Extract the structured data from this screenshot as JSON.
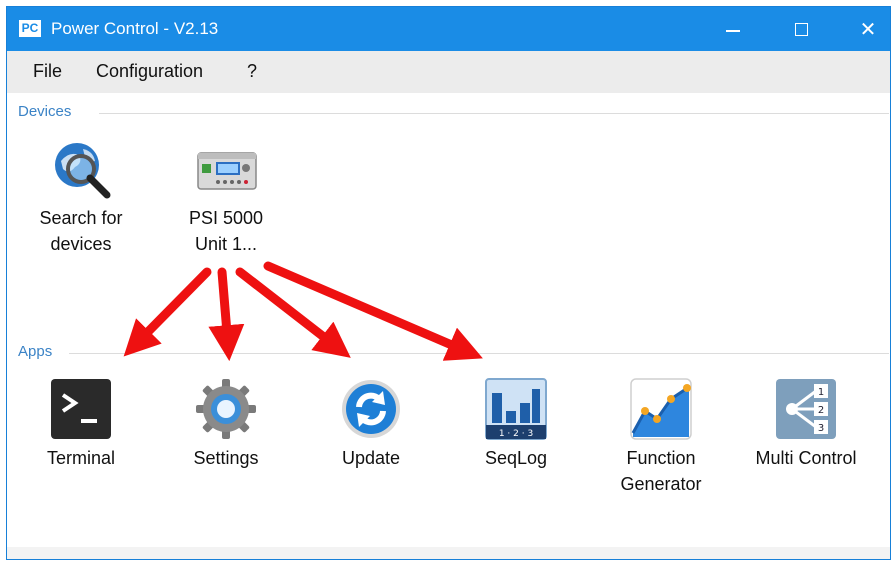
{
  "window": {
    "title": "Power Control - V2.13",
    "app_icon_text": "PC",
    "accent_color": "#1a8ce6"
  },
  "menu": {
    "items": [
      "File",
      "Configuration",
      "?"
    ]
  },
  "devices": {
    "label": "Devices",
    "items": [
      {
        "label": "Search for\ndevices",
        "icon": "globe-magnifier-icon"
      },
      {
        "label": "PSI 5000\nUnit 1...",
        "icon": "power-supply-icon"
      }
    ]
  },
  "apps": {
    "label": "Apps",
    "items": [
      {
        "label": "Terminal",
        "icon": "terminal-icon"
      },
      {
        "label": "Settings",
        "icon": "gear-icon"
      },
      {
        "label": "Update",
        "icon": "refresh-icon"
      },
      {
        "label": "SeqLog",
        "icon": "seqlog-icon"
      },
      {
        "label": "Function\nGenerator",
        "icon": "function-generator-icon"
      },
      {
        "label": "Multi Control",
        "icon": "multi-control-icon"
      }
    ]
  },
  "annotation": {
    "arrow_color": "#ee1111"
  }
}
